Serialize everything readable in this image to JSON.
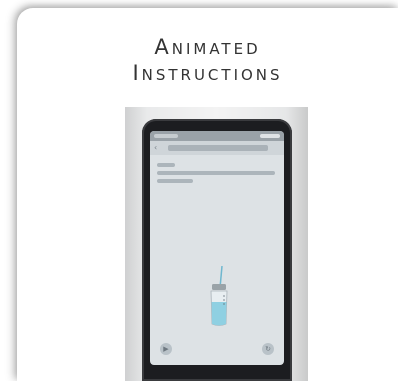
{
  "card": {
    "title_line1": "Animated",
    "title_line2": "Instructions"
  },
  "device": {
    "icons": {
      "back": "back-arrow-icon",
      "play": "play-icon",
      "refresh": "refresh-icon",
      "cup": "measuring-cup-icon"
    }
  },
  "colors": {
    "title": "#333333",
    "screen": "#dde2e5",
    "device_frame": "#1c1d20",
    "cup_liquid": "#8fd0e2"
  }
}
